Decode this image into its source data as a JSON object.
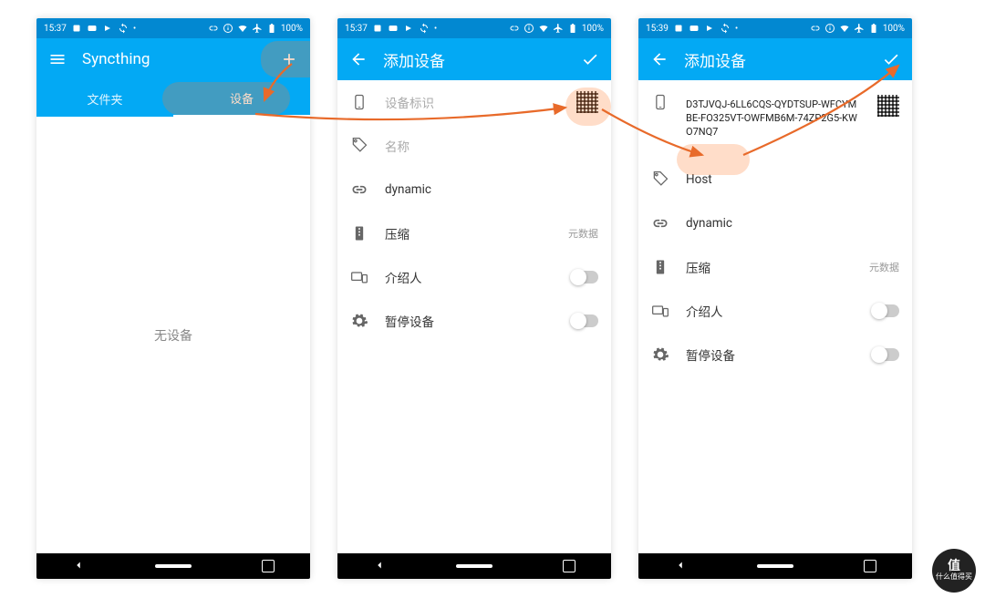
{
  "status": {
    "time_a": "15:37",
    "time_b": "15:37",
    "time_c": "15:39",
    "battery": "100%"
  },
  "screen1": {
    "app_title": "Syncthing",
    "tab_folders": "文件夹",
    "tab_devices": "设备",
    "empty": "无设备"
  },
  "screen2": {
    "title": "添加设备",
    "id_placeholder": "设备标识",
    "name_placeholder": "名称",
    "addresses": "dynamic",
    "compression_label": "压缩",
    "compression_value": "元数据",
    "introducer": "介绍人",
    "pause": "暂停设备"
  },
  "screen3": {
    "title": "添加设备",
    "device_id": "D3TJVQJ-6LL6CQS-QYDTSUP-WFCYMBE-FO325VT-OWFMB6M-74ZP2G5-KWO7NQ7",
    "name_value": "Host",
    "addresses": "dynamic",
    "compression_label": "压缩",
    "compression_value": "元数据",
    "introducer": "介绍人",
    "pause": "暂停设备"
  },
  "watermark": {
    "brand": "值",
    "text": "什么值得买"
  }
}
